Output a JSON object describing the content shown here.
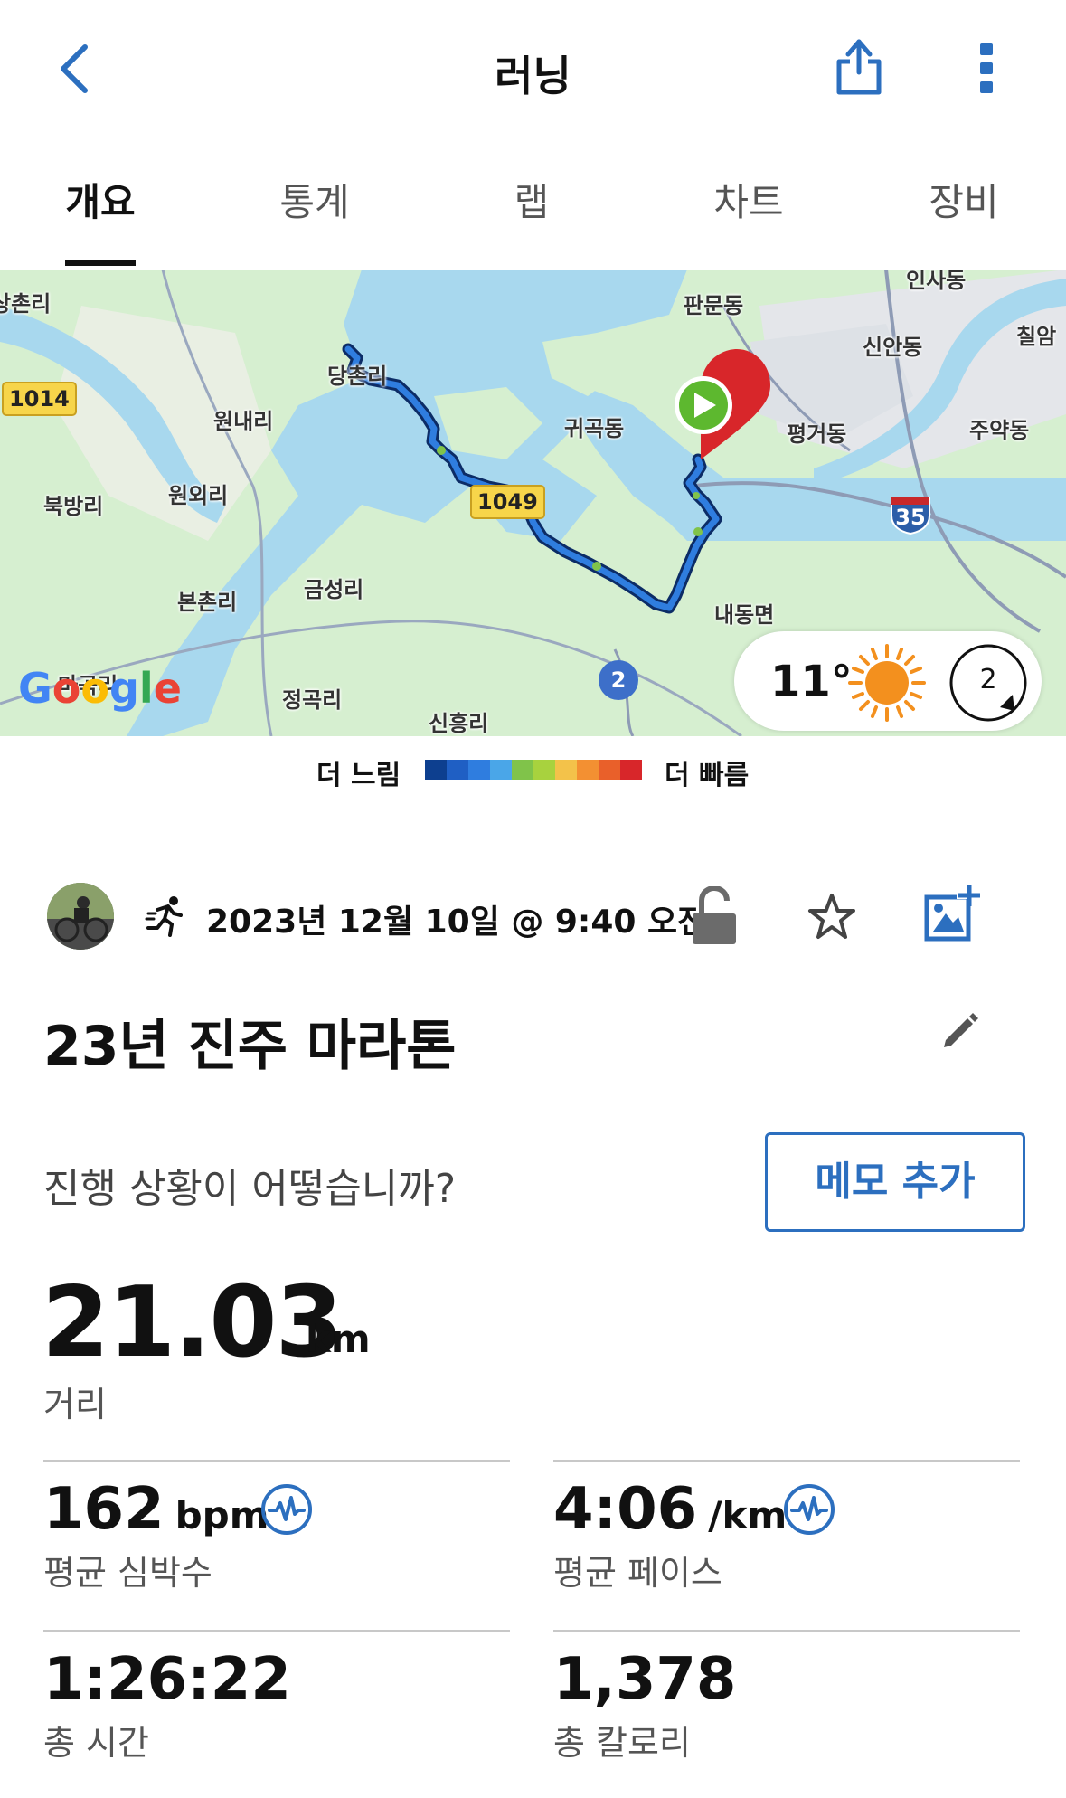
{
  "header": {
    "title": "러닝",
    "back_icon": "chevron-left-icon",
    "share_icon": "share-icon",
    "more_icon": "more-vertical-icon"
  },
  "tabs": [
    {
      "label": "개요",
      "active": true
    },
    {
      "label": "통계",
      "active": false
    },
    {
      "label": "랩",
      "active": false
    },
    {
      "label": "차트",
      "active": false
    },
    {
      "label": "장비",
      "active": false
    }
  ],
  "map": {
    "places": [
      "상촌리",
      "당촌리",
      "원내리",
      "원외리",
      "북방리",
      "본촌리",
      "금성리",
      "정곡리",
      "신흥리",
      "마곡리",
      "귀곡동",
      "판문동",
      "신안동",
      "평거동",
      "인사동",
      "칠암",
      "주약동",
      "내동면"
    ],
    "route_shields": [
      "1014",
      "1049"
    ],
    "route_circle": "2",
    "interstate": "35",
    "logo": "Google",
    "weather": {
      "temperature": "11°",
      "icon": "sun-icon",
      "wind": "2"
    }
  },
  "legend": {
    "slow_label": "더 느림",
    "fast_label": "더 빠름",
    "colors": [
      "#0d3f8f",
      "#1f5fc4",
      "#2f7ddf",
      "#4aa6e8",
      "#80c34a",
      "#a8d23e",
      "#f3c24a",
      "#f39032",
      "#e9602a",
      "#d8262a"
    ]
  },
  "activity": {
    "type_icon": "running-icon",
    "datetime": "2023년 12월 10일 @ 9:40 오전",
    "title": "23년 진주 마라톤",
    "question": "진행 상황이 어떻습니까?",
    "memo_button": "메모 추가"
  },
  "stats": {
    "distance": {
      "value": "21.03",
      "unit": "km",
      "label": "거리"
    },
    "heart_rate": {
      "value": "162",
      "unit": "bpm",
      "label": "평균 심박수"
    },
    "pace": {
      "value": "4:06",
      "unit": "/km",
      "label": "평균 페이스"
    },
    "time": {
      "value": "1:26:22",
      "label": "총 시간"
    },
    "calories": {
      "value": "1,378",
      "label": "총 칼로리"
    }
  },
  "colors": {
    "accent": "#2c6fbf",
    "text": "#111111",
    "secondary_text": "#555555",
    "water": "#a8d8ee",
    "land": "#d6efd0"
  }
}
